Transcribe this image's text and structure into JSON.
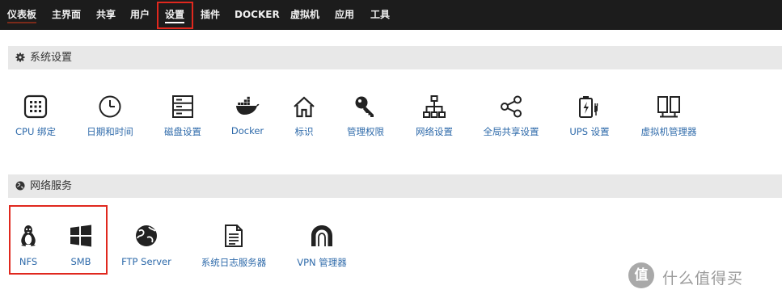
{
  "nav": {
    "items": [
      {
        "label": "仪表板"
      },
      {
        "label": "主界面"
      },
      {
        "label": "共享"
      },
      {
        "label": "用户"
      },
      {
        "label": "设置"
      },
      {
        "label": "插件"
      },
      {
        "label": "DOCKER"
      },
      {
        "label": "虚拟机"
      },
      {
        "label": "应用"
      },
      {
        "label": "工具"
      }
    ],
    "active": "设置"
  },
  "system_settings": {
    "title": "系统设置",
    "icon": "gear-icon",
    "tiles": [
      {
        "label": "CPU 绑定",
        "icon": "cpu-icon"
      },
      {
        "label": "日期和时间",
        "icon": "clock-icon"
      },
      {
        "label": "磁盘设置",
        "icon": "disk-icon"
      },
      {
        "label": "Docker",
        "icon": "docker-whale-icon"
      },
      {
        "label": "标识",
        "icon": "home-icon"
      },
      {
        "label": "管理权限",
        "icon": "key-icon"
      },
      {
        "label": "网络设置",
        "icon": "network-icon"
      },
      {
        "label": "全局共享设置",
        "icon": "share-icon"
      },
      {
        "label": "UPS 设置",
        "icon": "battery-plug-icon"
      },
      {
        "label": "虚拟机管理器",
        "icon": "vm-monitor-icon"
      }
    ]
  },
  "network_services": {
    "title": "网络服务",
    "icon": "globe-icon",
    "tiles": [
      {
        "label": "NFS",
        "icon": "linux-penguin-icon"
      },
      {
        "label": "SMB",
        "icon": "windows-icon"
      },
      {
        "label": "FTP Server",
        "icon": "ftp-globe-icon"
      },
      {
        "label": "系统日志服务器",
        "icon": "log-file-icon"
      },
      {
        "label": "VPN 管理器",
        "icon": "vpn-tunnel-icon"
      }
    ]
  },
  "watermark": {
    "badge": "值",
    "text": "什么值得买"
  },
  "colors": {
    "nav_bg": "#1c1c1c",
    "link": "#2e6aaa",
    "highlight": "#e0281e",
    "section_bg": "#e8e8e8"
  }
}
